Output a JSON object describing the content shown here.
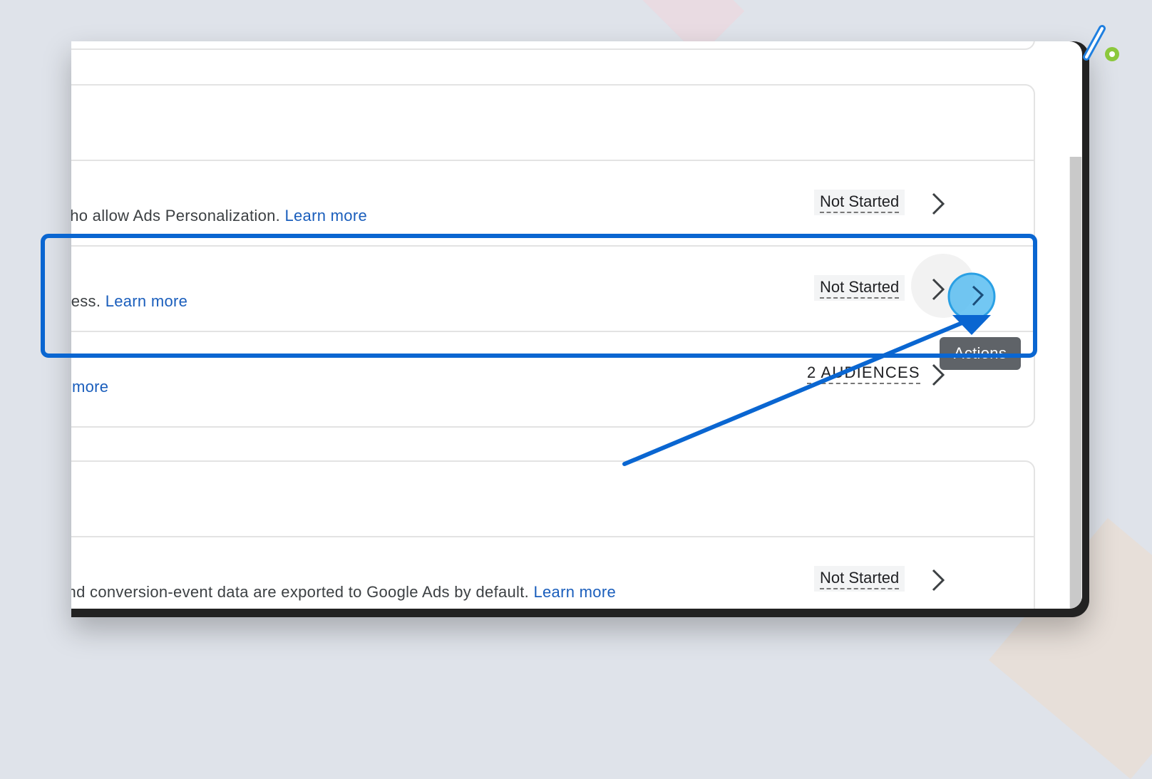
{
  "rows": [
    {
      "text": "who allow Ads Personalization. ",
      "link": "Learn more",
      "status": "Not Started"
    },
    {
      "text": "iness. ",
      "link": "Learn more",
      "status": "Not Started"
    },
    {
      "text": "",
      "link": "n more",
      "status": "2 AUDIENCES"
    },
    {
      "text": " and conversion-event data are exported to Google Ads by default. ",
      "link": "Learn more",
      "status": "Not Started"
    }
  ],
  "tooltip": "Actions",
  "colors": {
    "accent_blue": "#0a66d1",
    "link_blue": "#1a5ebc",
    "cursor_blue": "#4fb9f0",
    "logo_green": "#8cc83c"
  },
  "icons": {
    "row_action": "chevron-right-icon",
    "logo": "brand-logo-icon"
  }
}
